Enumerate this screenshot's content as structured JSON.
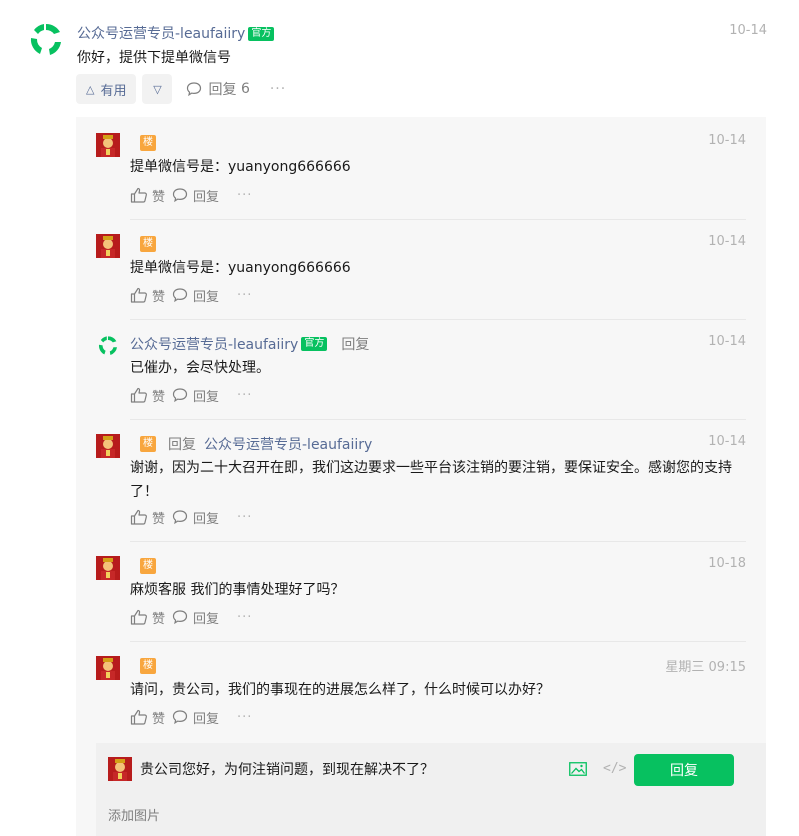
{
  "post": {
    "author": "公众号运营专员-leaufaiiry",
    "badge": "官方",
    "date": "10-14",
    "text": "你好，提供下提单微信号",
    "useful_label": "有用",
    "reply_label": "回复",
    "reply_count": "6",
    "more": "···"
  },
  "replies": [
    {
      "lou": "楼",
      "date": "10-14",
      "text": "提单微信号是：yuanyong666666",
      "like": "赞",
      "reply": "回复",
      "more": "···"
    },
    {
      "lou": "楼",
      "date": "10-14",
      "text": "提单微信号是：yuanyong666666",
      "like": "赞",
      "reply": "回复",
      "more": "···"
    },
    {
      "name": "公众号运营专员-leaufaiiry",
      "badge": "官方",
      "reply_word": "回复",
      "date": "10-14",
      "text": "已催办，会尽快处理。",
      "like": "赞",
      "reply": "回复",
      "more": "···"
    },
    {
      "lou": "楼",
      "reply_word": "回复",
      "target": "公众号运营专员-leaufaiiry",
      "date": "10-14",
      "text": "谢谢，因为二十大召开在即，我们这边要求一些平台该注销的要注销，要保证安全。感谢您的支持了！",
      "like": "赞",
      "reply": "回复",
      "more": "···"
    },
    {
      "lou": "楼",
      "date": "10-18",
      "text": "麻烦客服 我们的事情处理好了吗？",
      "like": "赞",
      "reply": "回复",
      "more": "···"
    },
    {
      "lou": "楼",
      "date": "星期三 09:15",
      "text": "请问，贵公司，我们的事现在的进展怎么样了，什么时候可以办好？",
      "like": "赞",
      "reply": "回复",
      "more": "···"
    }
  ],
  "reply_box": {
    "input_value": "贵公司您好，为何注销问题，到现在解决不了？",
    "code_label": "</>",
    "submit_label": "回复",
    "add_image": "添加图片"
  },
  "colors": {
    "accent": "#07c160",
    "link": "#576b95",
    "lou_badge": "#f8a63e"
  }
}
